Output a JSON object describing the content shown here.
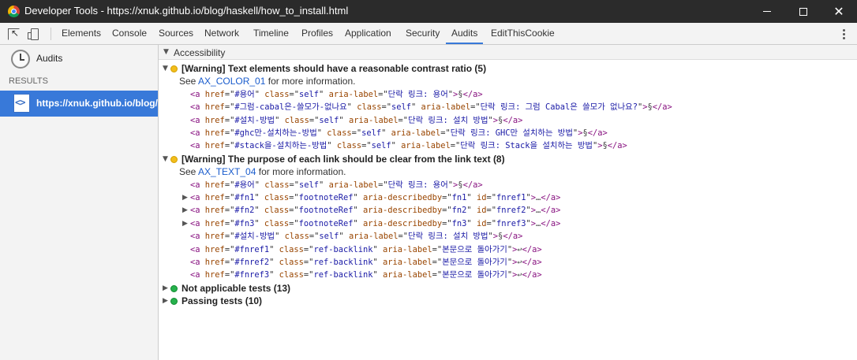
{
  "window": {
    "title": "Developer Tools - https://xnuk.github.io/blog/haskell/how_to_install.html",
    "close_glyph": "✕"
  },
  "tabs": [
    "Elements",
    "Console",
    "Sources",
    "Network",
    "Timeline",
    "Profiles",
    "Application",
    "Security",
    "Audits",
    "EditThisCookie"
  ],
  "active_tab": "Audits",
  "sidebar": {
    "audits_label": "Audits",
    "results_label": "RESULTS",
    "result_url": "https://xnuk.github.io/blog/haskell/how_to_install.html",
    "page_icon_text": "<>"
  },
  "category": "Accessibility",
  "groups": [
    {
      "status": "warning",
      "title": "[Warning] Text elements should have a reasonable contrast ratio (5)",
      "see_prefix": "See ",
      "see_link": "AX_COLOR_01",
      "see_suffix": " for more information.",
      "items": [
        {
          "href": "#용어",
          "class": "self",
          "label_attr": "aria-label",
          "label": "단락 링크: 용어",
          "inner": "§"
        },
        {
          "href": "#그럼-cabal은-쓸모가-없나요",
          "class": "self",
          "label_attr": "aria-label",
          "label": "단락 링크: 그럼 Cabal은 쓸모가 없나요?",
          "inner": "§"
        },
        {
          "href": "#설치-방법",
          "class": "self",
          "label_attr": "aria-label",
          "label": "단락 링크: 설치 방법",
          "inner": "§"
        },
        {
          "href": "#ghc만-설치하는-방법",
          "class": "self",
          "label_attr": "aria-label",
          "label": "단락 링크: GHC만 설치하는 방법",
          "inner": "§"
        },
        {
          "href": "#stack을-설치하는-방법",
          "class": "self",
          "label_attr": "aria-label",
          "label": "단락 링크: Stack을 설치하는 방법",
          "inner": "§"
        }
      ]
    },
    {
      "status": "warning",
      "title": "[Warning] The purpose of each link should be clear from the link text (8)",
      "see_prefix": "See ",
      "see_link": "AX_TEXT_04",
      "see_suffix": " for more information.",
      "items": [
        {
          "href": "#용어",
          "class": "self",
          "label_attr": "aria-label",
          "label": "단락 링크: 용어",
          "inner": "§"
        },
        {
          "href": "#fn1",
          "class": "footnoteRef",
          "label_attr": "aria-describedby",
          "label": "fn1",
          "id": "fnref1",
          "inner": "…",
          "expandable": true
        },
        {
          "href": "#fn2",
          "class": "footnoteRef",
          "label_attr": "aria-describedby",
          "label": "fn2",
          "id": "fnref2",
          "inner": "…",
          "expandable": true
        },
        {
          "href": "#fn3",
          "class": "footnoteRef",
          "label_attr": "aria-describedby",
          "label": "fn3",
          "id": "fnref3",
          "inner": "…",
          "expandable": true
        },
        {
          "href": "#설치-방법",
          "class": "self",
          "label_attr": "aria-label",
          "label": "단락 링크: 설치 방법",
          "inner": "§"
        },
        {
          "href": "#fnref1",
          "class": "ref-backlink",
          "label_attr": "aria-label",
          "label": "본문으로 돌아가기",
          "inner": "↩"
        },
        {
          "href": "#fnref2",
          "class": "ref-backlink",
          "label_attr": "aria-label",
          "label": "본문으로 돌아가기",
          "inner": "↩"
        },
        {
          "href": "#fnref3",
          "class": "ref-backlink",
          "label_attr": "aria-label",
          "label": "본문으로 돌아가기",
          "inner": "↩"
        }
      ]
    }
  ],
  "collapsed_groups": [
    {
      "status": "pass",
      "title": "Not applicable tests (13)"
    },
    {
      "status": "pass",
      "title": "Passing tests (10)"
    }
  ],
  "colors": {
    "accent": "#3879d9",
    "warning_dot": "#f2bd1b",
    "pass_dot": "#26b14c",
    "titlebar": "#2b2b2b"
  },
  "icons": [
    "chrome-logo-icon",
    "inspect-icon",
    "device-mode-icon",
    "more-icon",
    "clock-icon",
    "page-icon",
    "disclosure-triangle-icon"
  ]
}
